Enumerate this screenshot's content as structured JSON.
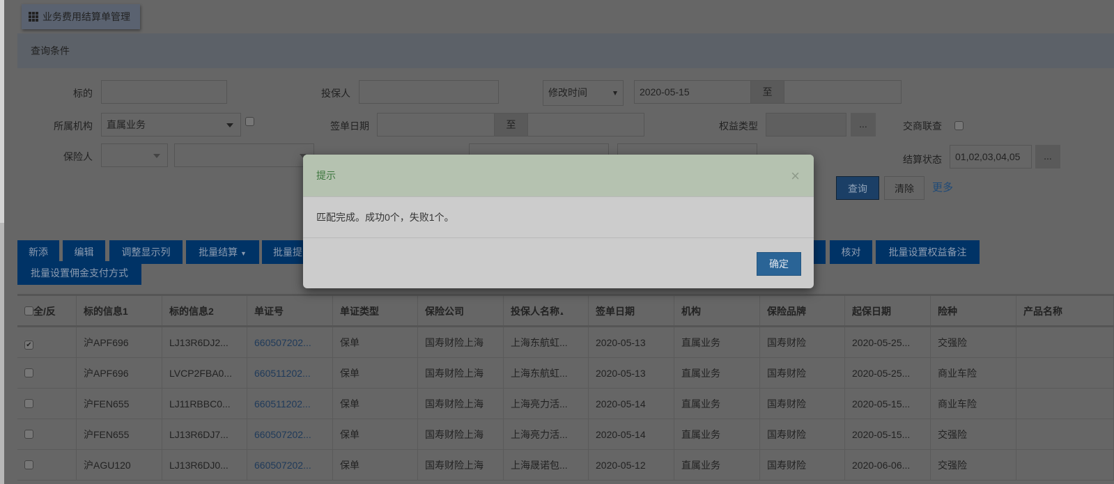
{
  "page": {
    "title": "业务费用结算单管理",
    "title_icon": "grid-icon"
  },
  "query": {
    "header": "查询条件",
    "biaodi_label": "标的",
    "biaodi_value": "",
    "toubaoren_label": "投保人",
    "toubaoren_value": "",
    "time_select": "修改时间",
    "date_from": "2020-05-15",
    "to": "至",
    "date_to": "",
    "org_label": "所属机构",
    "org_value": "直属业务",
    "sign_date_label": "签单日期",
    "sign_from": "",
    "sign_to": "",
    "equity_label": "权益类型",
    "equity_value": "",
    "ellipsis": "...",
    "cross_label": "交商联查",
    "insurer_label": "保险人",
    "status_label": "结算状态",
    "status_value": "01,02,03,04,05",
    "search": "查询",
    "clear": "清除",
    "more": "更多"
  },
  "toolbar": [
    "新添",
    "编辑",
    "调整显示列",
    "批量结算",
    "批量提",
    "核对",
    "批量设置权益备注",
    "批量设置佣金支付方式"
  ],
  "table": {
    "headers": [
      "全/反",
      "标的信息1",
      "标的信息2",
      "单证号",
      "单证类型",
      "保险公司",
      "投保人名称",
      "签单日期",
      "机构",
      "保险品牌",
      "起保日期",
      "险种",
      "产品名称"
    ],
    "sort_indicator": "▲",
    "rows": [
      {
        "checked": true,
        "c": [
          "沪APF696",
          "LJ13R6DJ2...",
          "660507202...",
          "保单",
          "国寿财险上海",
          "上海东航虹...",
          "2020-05-13",
          "直属业务",
          "国寿财险",
          "2020-05-25...",
          "交强险",
          ""
        ]
      },
      {
        "checked": false,
        "c": [
          "沪APF696",
          "LVCP2FBA0...",
          "660511202...",
          "保单",
          "国寿财险上海",
          "上海东航虹...",
          "2020-05-13",
          "直属业务",
          "国寿财险",
          "2020-05-25...",
          "商业车险",
          ""
        ]
      },
      {
        "checked": false,
        "c": [
          "沪FEN655",
          "LJ11RBBC0...",
          "660511202...",
          "保单",
          "国寿财险上海",
          "上海亮力活...",
          "2020-05-14",
          "直属业务",
          "国寿财险",
          "2020-05-15...",
          "商业车险",
          ""
        ]
      },
      {
        "checked": false,
        "c": [
          "沪FEN655",
          "LJ13R6DJ7...",
          "660507202...",
          "保单",
          "国寿财险上海",
          "上海亮力活...",
          "2020-05-14",
          "直属业务",
          "国寿财险",
          "2020-05-15...",
          "交强险",
          ""
        ]
      },
      {
        "checked": false,
        "c": [
          "沪AGU120",
          "LJ13R6DJ0...",
          "660507202...",
          "保单",
          "国寿财险上海",
          "上海晟诺包...",
          "2020-05-12",
          "直属业务",
          "国寿财险",
          "2020-06-06...",
          "交强险",
          ""
        ]
      }
    ]
  },
  "modal": {
    "title": "提示",
    "close": "×",
    "message": "匹配完成。成功0个，失败1个。",
    "ok": "确定"
  }
}
